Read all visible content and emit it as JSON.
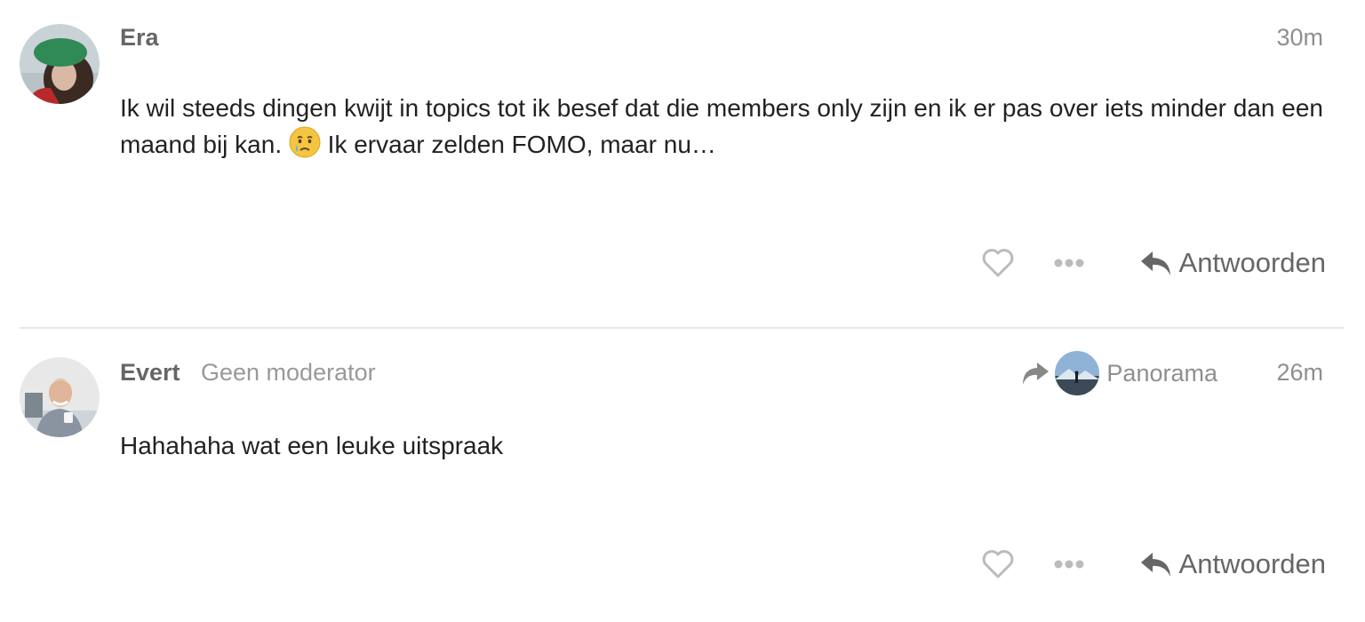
{
  "posts": [
    {
      "username": "Era",
      "user_title": "",
      "time": "30m",
      "avatar_icon": "user-avatar-green-beret",
      "body_part1": "Ik wil steeds dingen kwijt in topics tot ik besef dat die members only zijn en ik er pas over iets minder dan een maand bij kan.",
      "emoji": "crying-face-emoji",
      "body_part2": "Ik ervaar zelden FOMO, maar nu…",
      "reply_label": "Antwoorden"
    },
    {
      "username": "Evert",
      "user_title": "Geen moderator",
      "time": "26m",
      "avatar_icon": "user-avatar-older-man",
      "reply_to_name": "Panorama",
      "reply_to_icon": "user-avatar-mountain",
      "body": "Hahahaha wat een leuke uitspraak",
      "reply_label": "Antwoorden"
    }
  ],
  "colors": {
    "muted_text": "#999999",
    "username": "#666666",
    "divider": "#e6e6e6",
    "icon_gray": "#bbbbbb"
  }
}
